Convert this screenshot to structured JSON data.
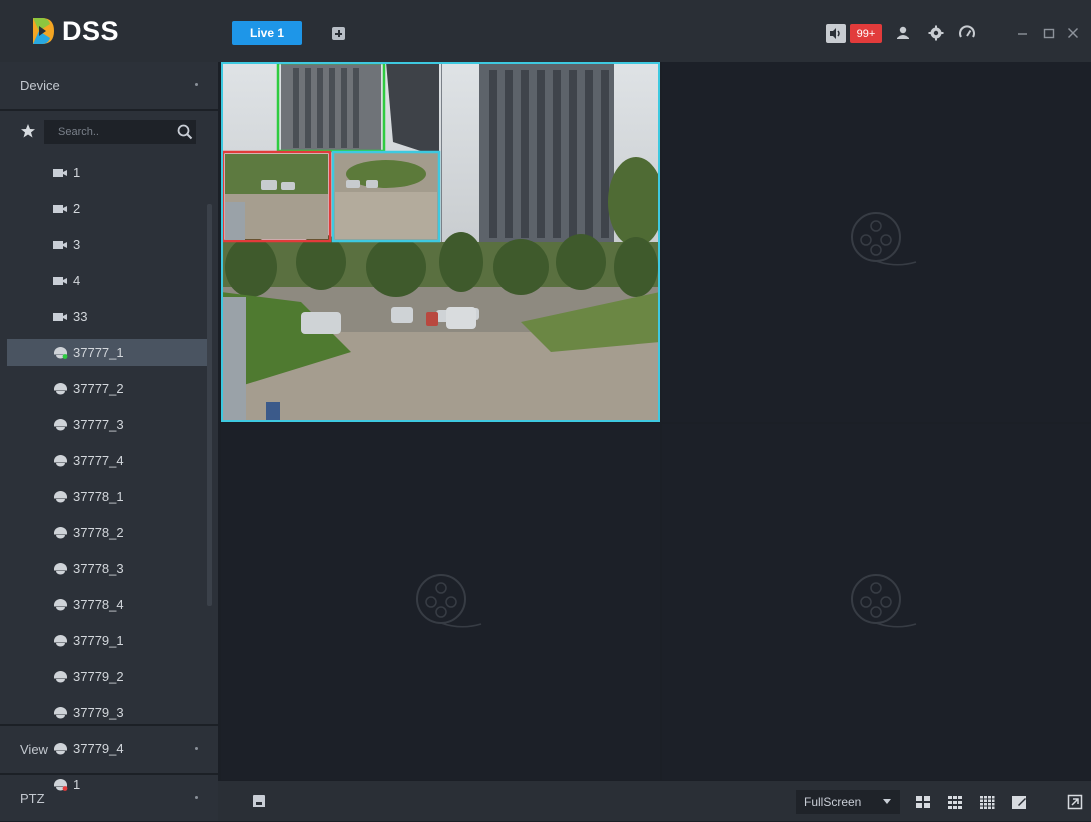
{
  "app": {
    "logo_text": "DSS"
  },
  "tabs": [
    {
      "label": "Live 1",
      "active": true
    }
  ],
  "header": {
    "alarm_count": "99+"
  },
  "sidebar": {
    "sections": [
      {
        "label": "Device"
      },
      {
        "label": "View"
      },
      {
        "label": "PTZ"
      }
    ],
    "search": {
      "placeholder": "Search.."
    },
    "items": [
      {
        "label": "1",
        "icon": "camera-icon"
      },
      {
        "label": "2",
        "icon": "camera-icon"
      },
      {
        "label": "3",
        "icon": "camera-icon"
      },
      {
        "label": "4",
        "icon": "camera-icon"
      },
      {
        "label": "33",
        "icon": "camera-icon"
      },
      {
        "label": "37777_1",
        "icon": "dome-camera-online-icon",
        "selected": true
      },
      {
        "label": "37777_2",
        "icon": "dome-camera-icon"
      },
      {
        "label": "37777_3",
        "icon": "dome-camera-icon"
      },
      {
        "label": "37777_4",
        "icon": "dome-camera-icon"
      },
      {
        "label": "37778_1",
        "icon": "dome-camera-icon"
      },
      {
        "label": "37778_2",
        "icon": "dome-camera-icon"
      },
      {
        "label": "37778_3",
        "icon": "dome-camera-icon"
      },
      {
        "label": "37778_4",
        "icon": "dome-camera-icon"
      },
      {
        "label": "37779_1",
        "icon": "dome-camera-icon"
      },
      {
        "label": "37779_2",
        "icon": "dome-camera-icon"
      },
      {
        "label": "37779_3",
        "icon": "dome-camera-icon"
      },
      {
        "label": "37779_4",
        "icon": "dome-camera-icon"
      },
      {
        "label": "1",
        "icon": "dome-camera-offline-icon"
      }
    ]
  },
  "bottom_bar": {
    "fullscreen_label": "FullScreen"
  },
  "colors": {
    "accent": "#1e96e8",
    "alarm": "#e23b3b",
    "selection_green": "#2ecc40",
    "selection_red": "#e23b3b",
    "selection_cyan": "#3ec9e0"
  }
}
